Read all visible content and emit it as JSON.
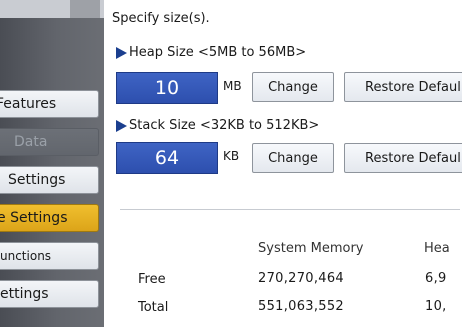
{
  "sidebar": {
    "items": [
      {
        "label": "Features",
        "state": "normal"
      },
      {
        "label": "Data",
        "state": "disabled"
      },
      {
        "label": "Settings",
        "state": "normal"
      },
      {
        "label": "e Settings",
        "state": "active"
      },
      {
        "label": "unctions",
        "state": "normal"
      },
      {
        "label": "ettings",
        "state": "normal"
      }
    ]
  },
  "main": {
    "instruction": "Specify size(s).",
    "heap": {
      "label": "Heap Size <5MB to 56MB>",
      "value": "10",
      "unit": "MB",
      "change_label": "Change",
      "restore_label": "Restore Defaul"
    },
    "stack": {
      "label": "Stack Size <32KB to 512KB>",
      "value": "64",
      "unit": "KB",
      "change_label": "Change",
      "restore_label": "Restore Defaul"
    },
    "table": {
      "headers": [
        "System Memory",
        "Hea"
      ],
      "rows": [
        {
          "label": "Free",
          "values": [
            "270,270,464",
            "6,9"
          ]
        },
        {
          "label": "Total",
          "values": [
            "551,063,552",
            "10,"
          ]
        }
      ]
    }
  },
  "colors": {
    "value_box": "#2d4fae",
    "active_item": "#e8b424",
    "arrow": "#1b3f8f"
  }
}
